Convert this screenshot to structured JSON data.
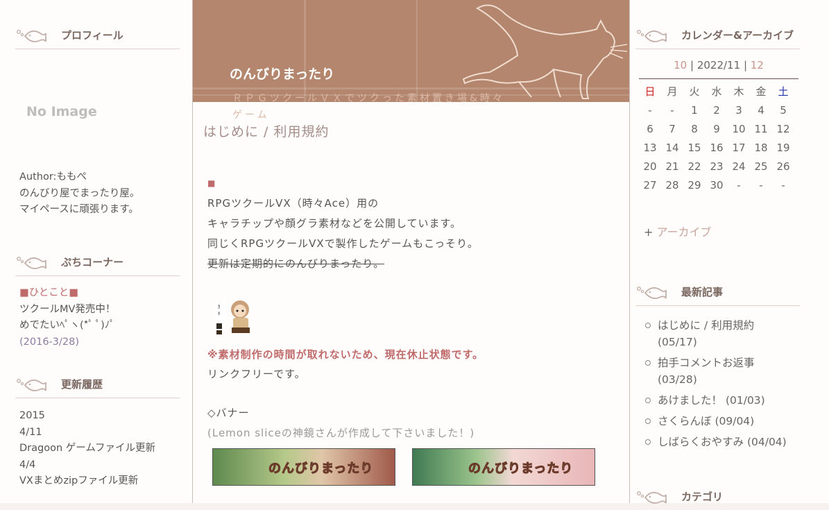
{
  "profile": {
    "heading": "プロフィール",
    "no_image": "No Image",
    "author_line": "Author:ももぺ",
    "desc_line1": "のんびり屋でまったり屋。",
    "desc_line2": "マイペースに頑張ります。"
  },
  "puchi": {
    "heading": "ぷちコーナー",
    "line1": "■ひとこと■",
    "line2": "ツクールMV発売中！",
    "line3": "めでたいﾍﾟヽ(*ﾟ ﾟ)ﾉﾟ",
    "line4": "(2016-3/28)"
  },
  "history": {
    "heading": "更新履歴",
    "lines": [
      "2015",
      "4/11",
      "Dragoon ゲームファイル更新",
      "4/4",
      "VXまとめzipファイル更新"
    ]
  },
  "site": {
    "title": "のんびりまったり",
    "subtitle": "ＲＰＧツクールＶＸでツクった素材置き場&時々ゲーム"
  },
  "post": {
    "title": "はじめに / 利用規約",
    "bullet": "■",
    "line1": "RPGツクールVX（時々Ace）用の",
    "line2": "キャラチップや顔グラ素材などを公開しています。",
    "line3": "同じくRPGツクールVXで製作したゲームもこっそり。",
    "line4_strike": "更新は定期的にのんびりまったり。",
    "notice": "※素材制作の時間が取れないため、現在休止状態です。",
    "link_free": "リンクフリーです。",
    "banner_heading": "◇バナー",
    "banner_credit": "(Lemon sliceの神鏡さんが作成して下さいました！)",
    "banner_text": "のんびりまったり"
  },
  "calendar": {
    "heading": "カレンダー&アーカイブ",
    "prev": "10",
    "current": "2022/11",
    "next": "12",
    "sep": "|",
    "weekdays": [
      "日",
      "月",
      "火",
      "水",
      "木",
      "金",
      "土"
    ],
    "rows": [
      [
        "-",
        "-",
        "1",
        "2",
        "3",
        "4",
        "5"
      ],
      [
        "6",
        "7",
        "8",
        "9",
        "10",
        "11",
        "12"
      ],
      [
        "13",
        "14",
        "15",
        "16",
        "17",
        "18",
        "19"
      ],
      [
        "20",
        "21",
        "22",
        "23",
        "24",
        "25",
        "26"
      ],
      [
        "27",
        "28",
        "29",
        "30",
        "-",
        "-",
        "-"
      ]
    ],
    "archive_plus": "+",
    "archive_label": "アーカイブ"
  },
  "recent": {
    "heading": "最新記事",
    "items": [
      {
        "title": "はじめに / 利用規約",
        "date": "(05/17)"
      },
      {
        "title": "拍手コメントお返事",
        "date": "(03/28)"
      },
      {
        "title": "あけました！",
        "date": "(01/03)"
      },
      {
        "title": "さくらんぼ",
        "date": "(09/04)"
      },
      {
        "title": "しばらくおやすみ",
        "date": "(04/04)"
      }
    ]
  },
  "category": {
    "heading": "カテゴリ"
  }
}
